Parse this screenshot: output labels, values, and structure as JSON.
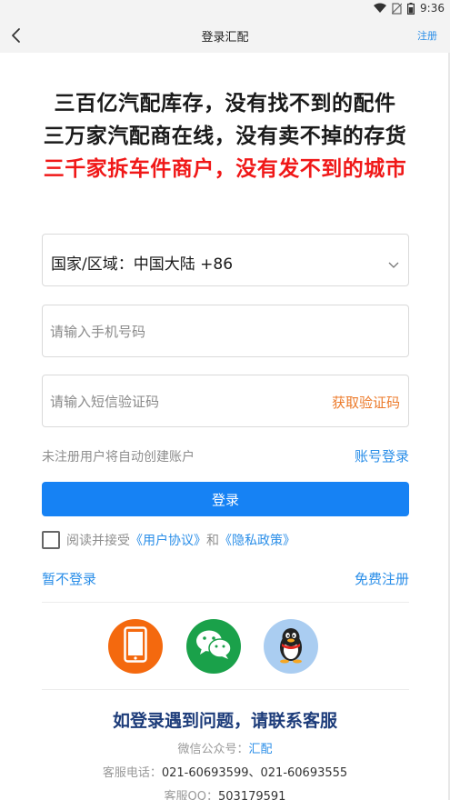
{
  "status_bar": {
    "time": "9:36",
    "icons": [
      "wifi-icon",
      "sim-off-icon",
      "battery-icon"
    ]
  },
  "nav": {
    "back_icon": "chevron-left-icon",
    "title": "登录汇配",
    "register": "注册"
  },
  "slogan": {
    "line1": "三百亿汽配库存，没有找不到的配件",
    "line2": "三万家汽配商在线，没有卖不掉的存货",
    "line3": "三千家拆车件商户，没有发不到的城市"
  },
  "form": {
    "region_label": "国家/区域：中国大陆 +86",
    "region_icon": "chevron-down-icon",
    "phone_placeholder": "请输入手机号码",
    "phone_value": "",
    "code_placeholder": "请输入短信验证码",
    "code_value": "",
    "get_code": "获取验证码",
    "auto_hint": "未注册用户将自动创建账户",
    "account_login": "账号登录",
    "login_button": "登录"
  },
  "agreement": {
    "checked": false,
    "prefix": "阅读并接受",
    "user_agreement": "《用户协议》",
    "and": "和",
    "privacy_policy": "《隐私政策》"
  },
  "links": {
    "skip_login": "暂不登录",
    "free_register": "免费注册"
  },
  "social": [
    {
      "name": "phone-login",
      "icon": "mobile-phone-icon",
      "color": "#f4690e"
    },
    {
      "name": "wechat-login",
      "icon": "wechat-icon",
      "color": "#1aa14a"
    },
    {
      "name": "qq-login",
      "icon": "qq-penguin-icon",
      "color": "#aacdf1"
    }
  ],
  "help": {
    "title": "如登录遇到问题，请联系客服",
    "wechat_label": "微信公众号：",
    "wechat_value": "汇配",
    "phone_label": "客服电话：",
    "phone_value": "021-60693599、021-60693555",
    "qq_label": "客服QQ：",
    "qq_value": "503179591"
  },
  "colors": {
    "accent_blue": "#1682f4",
    "link_blue": "#2a8ee8",
    "slogan_red": "#f01818",
    "get_code_orange": "#ec7a2a",
    "help_navy": "#1d3c7a"
  }
}
